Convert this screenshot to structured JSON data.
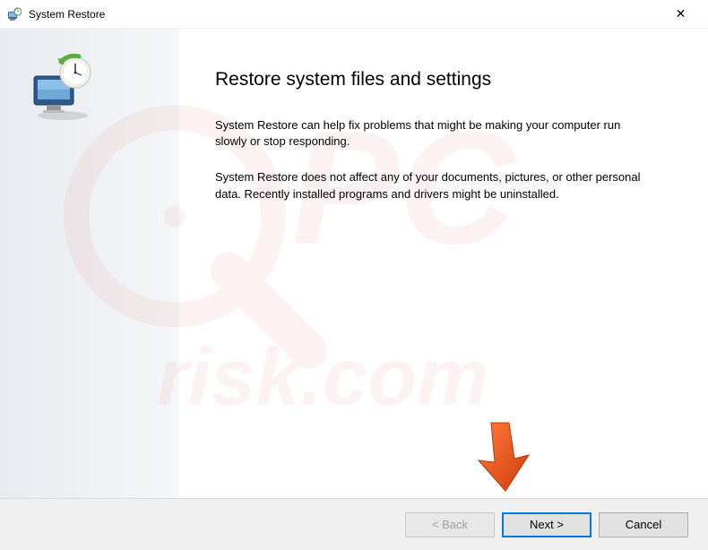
{
  "titlebar": {
    "title": "System Restore",
    "close_symbol": "✕"
  },
  "content": {
    "heading": "Restore system files and settings",
    "paragraph1": "System Restore can help fix problems that might be making your computer run slowly or stop responding.",
    "paragraph2": "System Restore does not affect any of your documents, pictures, or other personal data. Recently installed programs and drivers might be uninstalled."
  },
  "buttons": {
    "back_label": "< Back",
    "next_label": "Next >",
    "cancel_label": "Cancel"
  }
}
